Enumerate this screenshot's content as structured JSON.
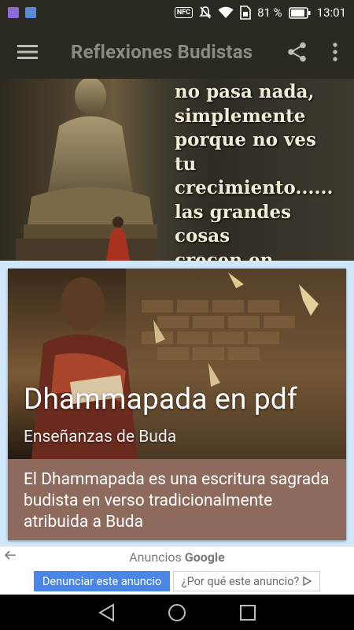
{
  "status_bar": {
    "battery_percent": "81 %",
    "time": "13:01",
    "nfc_label": "NFC"
  },
  "toolbar": {
    "title": "Reflexiones Budistas",
    "icons": [
      "menu-icon",
      "share-icon",
      "more-vert-icon"
    ]
  },
  "banner": {
    "quote_lines": [
      "no pasa nada,",
      "simplemente",
      "porque no ves",
      "tu crecimiento......",
      "las grandes cosas",
      "crecen en silencio."
    ]
  },
  "card": {
    "title": "Dhammapada en pdf",
    "subtitle": "Enseñanzas de Buda",
    "description": "El Dhammapada es una escritura sagrada budista en verso tradicionalmente atribuida a Buda",
    "background_color": "#8e6a5d"
  },
  "ad": {
    "label": "Anuncios",
    "brand": "Google",
    "report_button": "Denunciar este anuncio",
    "why_button": "¿Por qué este anuncio?"
  },
  "colors": {
    "toolbar_bg": "#2b2a22",
    "title_color": "#8b8b80",
    "report_button_bg": "#4a86e8"
  }
}
